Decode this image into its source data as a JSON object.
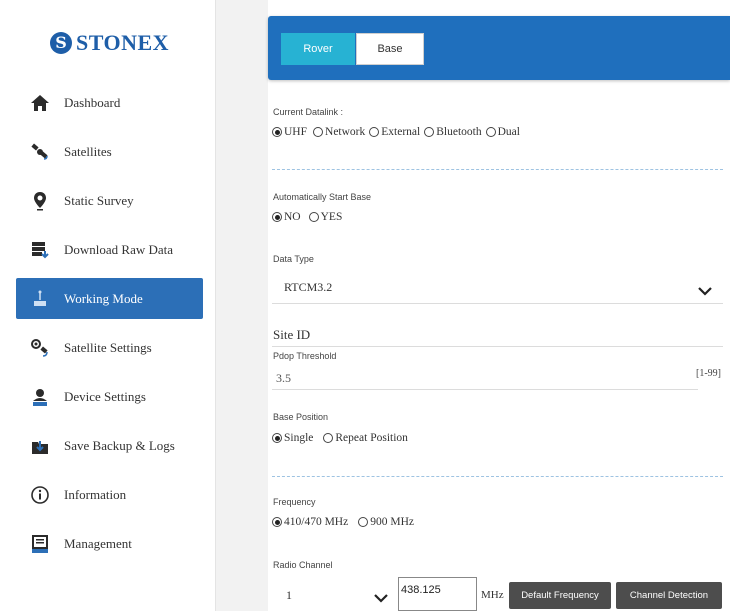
{
  "brand": {
    "name": "STONEX",
    "color": "#1e5ea8"
  },
  "sidebar": {
    "items": [
      {
        "label": "Dashboard",
        "icon": "home-icon"
      },
      {
        "label": "Satellites",
        "icon": "satellite-icon"
      },
      {
        "label": "Static Survey",
        "icon": "location-pin-icon"
      },
      {
        "label": "Download Raw Data",
        "icon": "download-data-icon"
      },
      {
        "label": "Working Mode",
        "icon": "working-mode-icon",
        "active": true
      },
      {
        "label": "Satellite Settings",
        "icon": "satellite-settings-icon"
      },
      {
        "label": "Device Settings",
        "icon": "device-settings-icon"
      },
      {
        "label": "Save Backup & Logs",
        "icon": "backup-icon"
      },
      {
        "label": "Information",
        "icon": "info-icon"
      },
      {
        "label": "Management",
        "icon": "management-icon"
      }
    ]
  },
  "tabs": {
    "rover": "Rover",
    "base": "Base",
    "selected": "Base"
  },
  "datalink": {
    "label": "Current Datalink :",
    "options": [
      "UHF",
      "Network",
      "External",
      "Bluetooth",
      "Dual"
    ],
    "selected": "UHF"
  },
  "autostart": {
    "label": "Automatically Start Base",
    "options": [
      "NO",
      "YES"
    ],
    "selected": "NO"
  },
  "datatype": {
    "label": "Data Type",
    "value": "RTCM3.2"
  },
  "site": {
    "title": "Site ID"
  },
  "pdop": {
    "label": "Pdop Threshold",
    "value": "3.5",
    "range": "[1-99]"
  },
  "base_position": {
    "label": "Base Position",
    "options": [
      "Single",
      "Repeat Position"
    ],
    "selected": "Single"
  },
  "frequency": {
    "label": "Frequency",
    "options": [
      "410/470 MHz",
      "900 MHz"
    ],
    "selected": "410/470 MHz"
  },
  "radio_channel": {
    "label": "Radio Channel",
    "channel": "1",
    "freq_value": "438.125",
    "unit": "MHz",
    "default_button": "Default Frequency",
    "detect_button": "Channel Detection"
  },
  "colors": {
    "accent": "#1f6fbd",
    "active_tab": "#27b2d3",
    "active_nav": "#2c6fb7"
  }
}
